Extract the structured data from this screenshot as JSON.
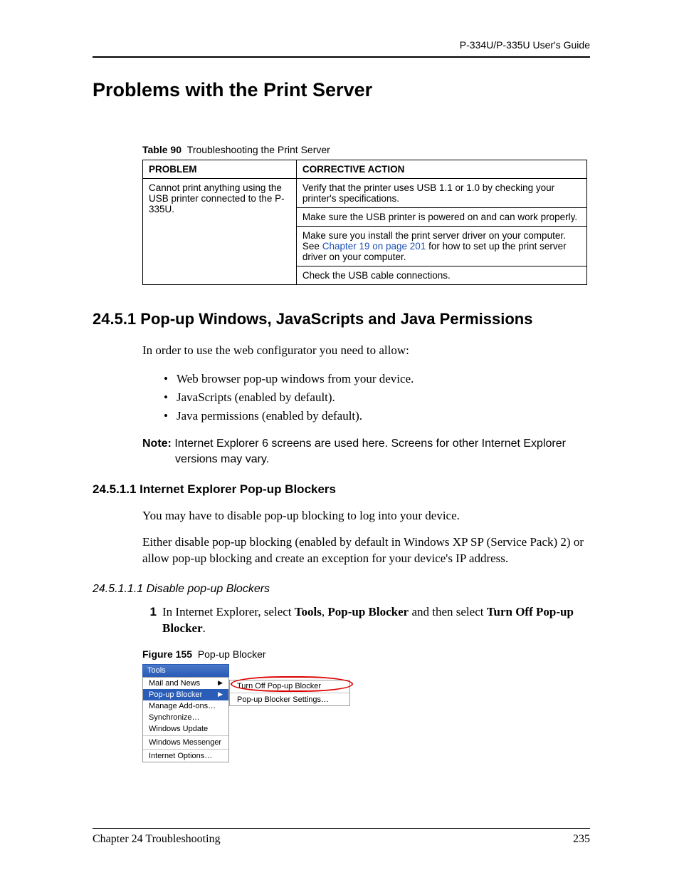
{
  "header": {
    "running": "P-334U/P-335U User's Guide"
  },
  "title": "Problems with the Print Server",
  "table": {
    "caption_label": "Table 90",
    "caption_text": "Troubleshooting the Print Server",
    "headers": {
      "col1": "PROBLEM",
      "col2": "CORRECTIVE ACTION"
    },
    "problem": "Cannot print anything using the USB printer connected to the P-335U.",
    "actions": [
      "Verify that the printer uses USB 1.1 or 1.0 by checking your printer's specifications.",
      "Make sure the USB printer is powered on and can work properly.",
      {
        "pre": "Make sure you install the print server driver on your computer. See ",
        "link1": "Chapter 19 on page 201",
        "post": " for how to set up the print server driver on your computer."
      },
      "Check the USB cable connections."
    ]
  },
  "s2451": {
    "heading": "24.5.1  Pop-up Windows, JavaScripts and Java Permissions",
    "intro": "In order to use the web configurator you need to allow:",
    "bullets": [
      "Web browser pop-up windows from your device.",
      "JavaScripts (enabled by default).",
      "Java permissions (enabled by default)."
    ],
    "note_label": "Note:",
    "note_text": "Internet Explorer 6 screens are used here. Screens for other Internet Explorer versions may vary."
  },
  "s24511": {
    "heading": "24.5.1.1  Internet Explorer Pop-up Blockers",
    "p1": "You may have to disable pop-up blocking to log into your device.",
    "p2": "Either disable pop-up blocking (enabled by default in Windows XP SP (Service Pack) 2) or allow pop-up blocking and create an exception for your device's IP address."
  },
  "s245111": {
    "heading": "24.5.1.1.1  Disable pop-up Blockers",
    "step1_num": "1",
    "step1_pre": "In Internet Explorer, select ",
    "step1_b1": "Tools",
    "step1_mid1": ", ",
    "step1_b2": "Pop-up Blocker",
    "step1_mid2": " and then select ",
    "step1_b3": "Turn Off Pop-up Blocker",
    "step1_post": "."
  },
  "figure": {
    "caption_label": "Figure 155",
    "caption_text": "Pop-up Blocker",
    "menu_title": "Tools",
    "items": [
      "Mail and News",
      "Pop-up Blocker",
      "Manage Add-ons…",
      "Synchronize…",
      "Windows Update",
      "Windows Messenger",
      "Internet Options…"
    ],
    "sub_items": [
      "Turn Off Pop-up Blocker",
      "Pop-up Blocker Settings…"
    ]
  },
  "footer": {
    "chapter": "Chapter 24 Troubleshooting",
    "page": "235"
  }
}
